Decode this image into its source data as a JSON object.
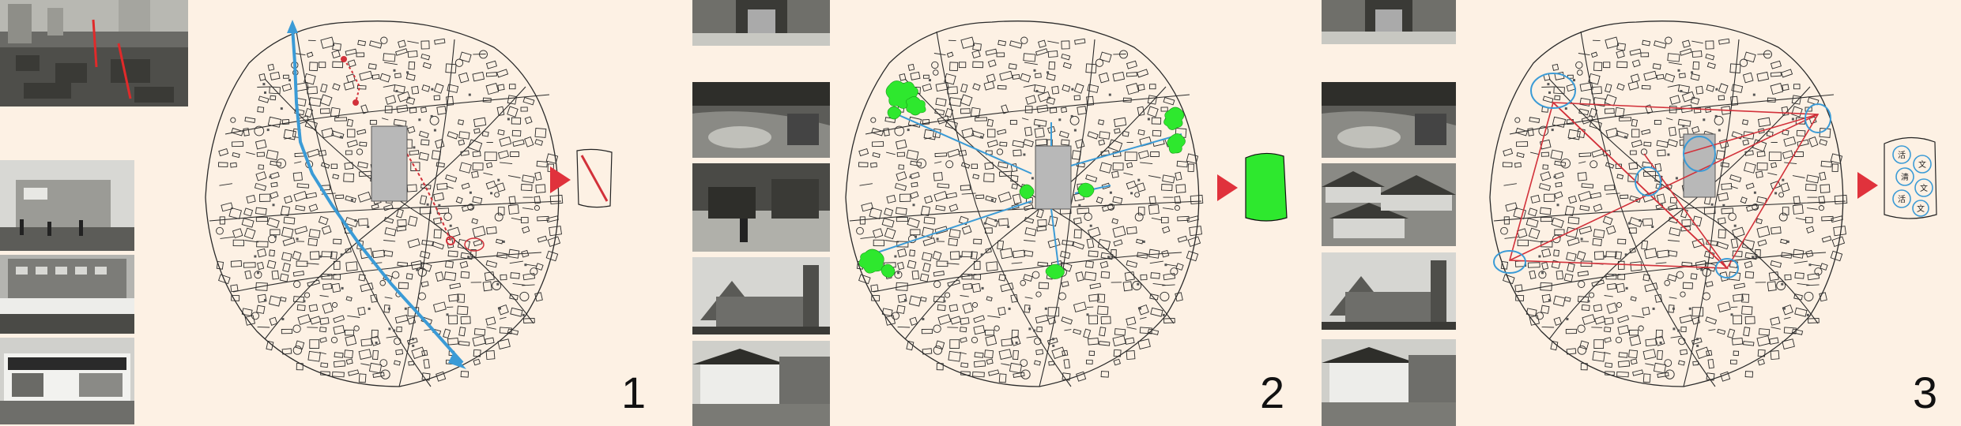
{
  "panels": [
    {
      "number": "1"
    },
    {
      "number": "2"
    },
    {
      "number": "3"
    }
  ],
  "legend_glyphs": [
    "活",
    "文",
    "清",
    "文",
    "活",
    "文"
  ],
  "colors": {
    "background": "#fdf1e4",
    "route_blue": "#3b9bd6",
    "route_red": "#d2313a",
    "green_space": "#2ee82e",
    "map_line": "#2a2a2a",
    "arrow_red": "#e0323c"
  },
  "icons": [
    "red-play-arrow-icon",
    "diagonal-line-icon",
    "green-block-icon",
    "circle-glyph-icon"
  ]
}
